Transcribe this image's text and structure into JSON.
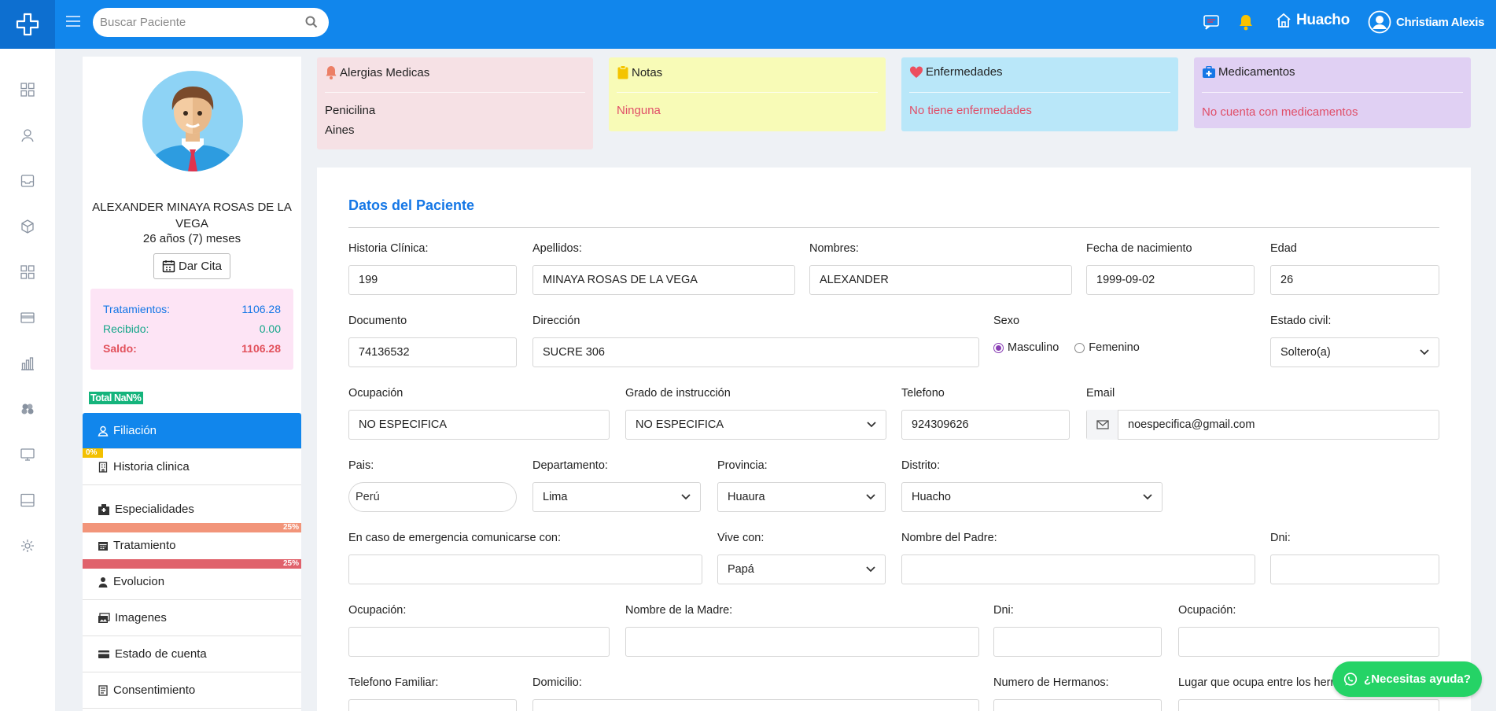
{
  "colors": {
    "primary": "#1186ec",
    "allergy_bg": "#f6e1e5",
    "notes_bg": "#f8fbb7",
    "disease_bg": "#b9e7f9",
    "meds_bg": "#e0d0f3",
    "balance_bg": "#fde4f5",
    "whatsapp": "#25d366"
  },
  "header": {
    "logo_icon": "medical-cross-icon",
    "search_placeholder": "Buscar Paciente",
    "branch": "Huacho",
    "user": "Christiam Alexis"
  },
  "sidebar_icons": [
    "dashboard-icon",
    "patient-icon",
    "inbox-icon",
    "box-icon",
    "apps-icon",
    "credit-card-icon",
    "bar-chart-icon",
    "clinic-icon",
    "monitor-icon",
    "tablet-icon",
    "gear-icon"
  ],
  "patient": {
    "name": "ALEXANDER MINAYA ROSAS DE LA VEGA",
    "age": "26 años (7) meses",
    "cita_label": "Dar Cita",
    "balance": {
      "treatments_label": "Tratamientos:",
      "treatments_value": "1106.28",
      "received_label": "Recibido:",
      "received_value": "0.00",
      "balance_label": "Saldo:",
      "balance_value": "1106.28"
    },
    "total_badge": "Total NaN%"
  },
  "nav": [
    {
      "label": "Filiación",
      "icon": "user-icon"
    },
    {
      "label": "Historia clinica",
      "icon": "building-icon",
      "bar": "0%"
    },
    {
      "label": "Especialidades",
      "icon": "hospital-icon"
    },
    {
      "label": "Tratamiento",
      "icon": "calendar-icon",
      "bar": "25%"
    },
    {
      "label": "Evolucion",
      "icon": "doctor-icon",
      "bar": "25%"
    },
    {
      "label": "Imagenes",
      "icon": "images-icon"
    },
    {
      "label": "Estado de cuenta",
      "icon": "card-icon"
    },
    {
      "label": "Consentimiento",
      "icon": "file-icon"
    }
  ],
  "cards": {
    "allergies": {
      "title": "Alergias Medicas",
      "items": [
        "Penicilina",
        "Aines"
      ]
    },
    "notes": {
      "title": "Notas",
      "value": "Ninguna"
    },
    "diseases": {
      "title": "Enfermedades",
      "value": "No tiene enfermedades"
    },
    "meds": {
      "title": "Medicamentos",
      "value": "No cuenta con medicamentos"
    }
  },
  "form": {
    "title": "Datos del Paciente",
    "historia_label": "Historia Clínica:",
    "historia": "199",
    "apellidos_label": "Apellidos:",
    "apellidos": "MINAYA ROSAS DE LA VEGA",
    "nombres_label": "Nombres:",
    "nombres": "ALEXANDER",
    "fecha_label": "Fecha de nacimiento",
    "fecha": "1999-09-02",
    "edad_label": "Edad",
    "edad": "26",
    "documento_label": "Documento",
    "documento": "74136532",
    "direccion_label": "Dirección",
    "direccion": "SUCRE 306",
    "sexo_label": "Sexo",
    "sexo_m": "Masculino",
    "sexo_f": "Femenino",
    "civil_label": "Estado civil:",
    "civil": "Soltero(a)",
    "ocupacion_label": "Ocupación",
    "ocupacion": "NO ESPECIFICA",
    "grado_label": "Grado de instrucción",
    "grado": "NO ESPECIFICA",
    "telefono_label": "Telefono",
    "telefono": "924309626",
    "email_label": "Email",
    "email": "noespecifica@gmail.com",
    "pais_label": "Pais:",
    "pais": "Perú",
    "depto_label": "Departamento:",
    "depto": "Lima",
    "provincia_label": "Provincia:",
    "provincia": "Huaura",
    "distrito_label": "Distrito:",
    "distrito": "Huacho",
    "emergencia_label": "En caso de emergencia comunicarse con:",
    "vive_label": "Vive con:",
    "vive": "Papá",
    "padre_label": "Nombre del Padre:",
    "dni_padre_label": "Dni:",
    "ocup_padre_label": "Ocupación:",
    "madre_label": "Nombre de la Madre:",
    "dni_madre_label": "Dni:",
    "ocup_madre_label": "Ocupación:",
    "tel_fam_label": "Telefono Familiar:",
    "domicilio_label": "Domicilio:",
    "hermanos_label": "Numero de Hermanos:",
    "lugar_label": "Lugar que ocupa entre los hermanos:"
  },
  "whatsapp": "¿Necesitas ayuda?"
}
